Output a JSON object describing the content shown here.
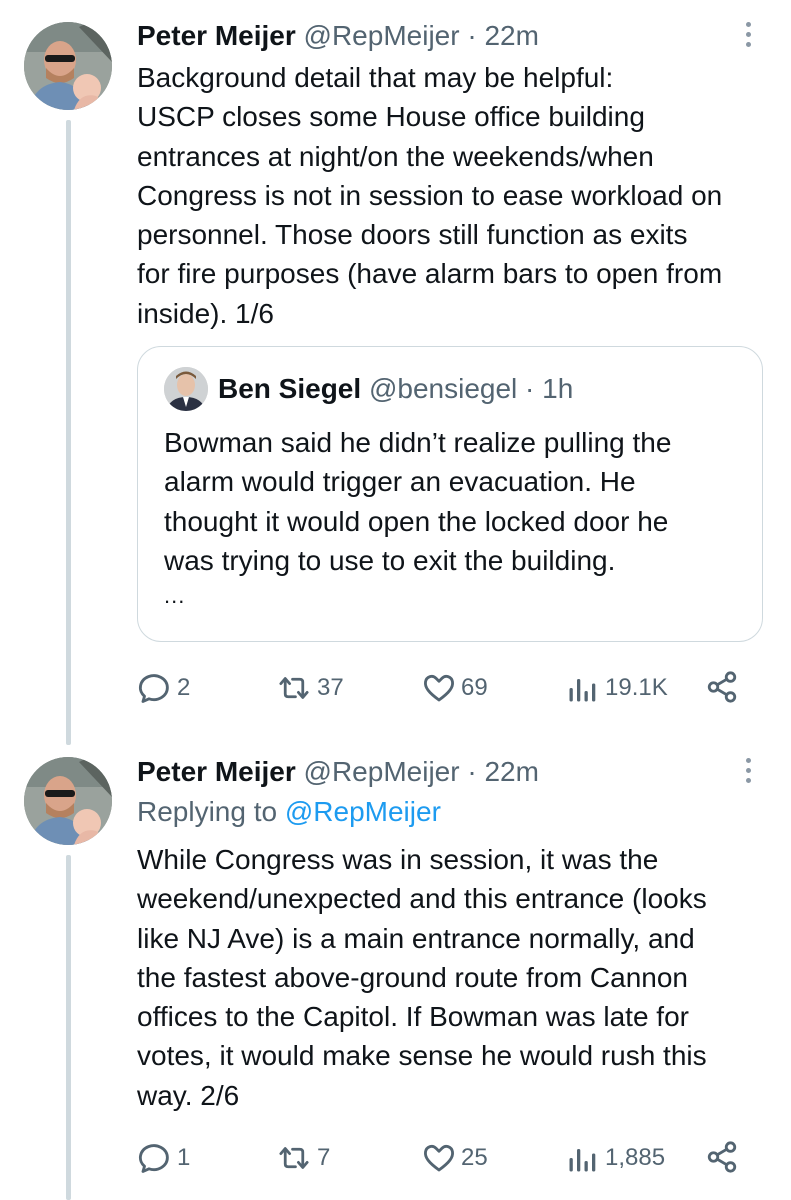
{
  "colors": {
    "text": "#0f1419",
    "secondary": "#536471",
    "link": "#1d9bf0",
    "border": "#cfd9de"
  },
  "tweets": [
    {
      "author_name": "Peter Meijer",
      "handle": "@RepMeijer",
      "separator": "·",
      "time": "22m",
      "text": "Background detail that may be helpful:\nUSCP closes some House office building\nentrances at night/on the weekends/when\nCongress is not in session to ease workload on\npersonnel. Those doors still function as exits\nfor fire purposes (have alarm bars to open from\ninside). 1/6",
      "quote": {
        "author_name": "Ben Siegel",
        "handle": "@bensiegel",
        "separator": "·",
        "time": "1h",
        "text": "Bowman said he didn’t realize pulling the\nalarm would trigger an evacuation. He\nthought it would open the locked door he\nwas trying to use to exit the building.",
        "ellipsis": "..."
      },
      "stats": {
        "replies": "2",
        "retweets": "37",
        "likes": "69",
        "views": "19.1K"
      }
    },
    {
      "author_name": "Peter Meijer",
      "handle": "@RepMeijer",
      "separator": "·",
      "time": "22m",
      "replying_prefix": "Replying to",
      "replying_handle": "@RepMeijer",
      "text": "While Congress was in session, it was the\nweekend/unexpected and this entrance (looks\nlike NJ Ave) is a main entrance normally, and\nthe fastest above-ground route from Cannon\noffices to the Capitol. If Bowman was late for\nvotes, it would make sense he would rush this\nway. 2/6",
      "stats": {
        "replies": "1",
        "retweets": "7",
        "likes": "25",
        "views": "1,885"
      }
    }
  ]
}
